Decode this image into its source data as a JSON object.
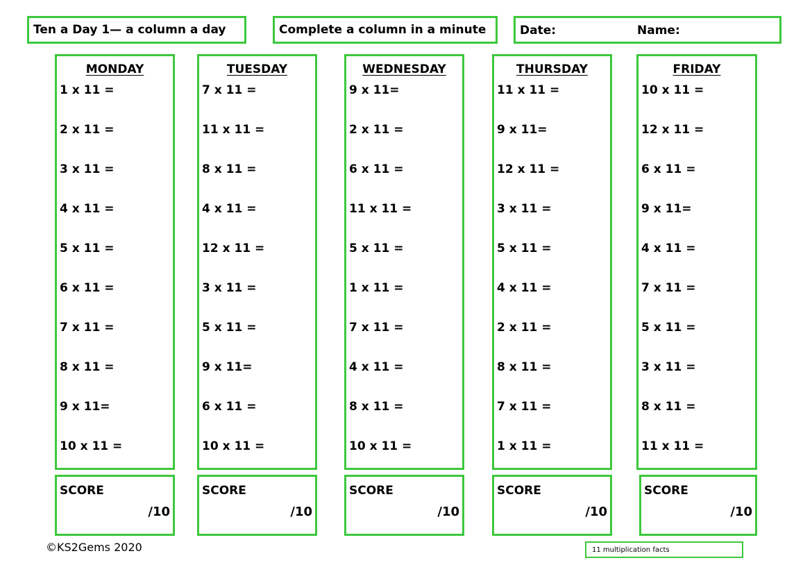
{
  "header": {
    "title": "Ten a Day 1— a column a day",
    "instruction": "Complete a column in a minute",
    "date_label": "Date:",
    "name_label": "Name:"
  },
  "columns": [
    {
      "day": "MONDAY",
      "questions": [
        "1 x 11 =",
        "2 x 11 =",
        "3 x 11 =",
        "4 x 11 =",
        "5 x 11 =",
        "6 x 11 =",
        "7 x 11 =",
        "8 x 11 =",
        "9 x 11=",
        "10 x 11 ="
      ]
    },
    {
      "day": "TUESDAY",
      "questions": [
        "7 x 11 =",
        "11 x 11 =",
        "8 x 11 =",
        "4 x 11 =",
        "12 x 11 =",
        "3 x 11 =",
        "5 x 11 =",
        "9 x 11=",
        "6 x 11 =",
        "10 x 11 ="
      ]
    },
    {
      "day": "WEDNESDAY",
      "questions": [
        "9 x 11=",
        "2 x 11 =",
        "6 x 11 =",
        "11 x 11 =",
        "5 x 11 =",
        "1 x 11 =",
        "7 x 11 =",
        "4 x 11 =",
        "8 x 11 =",
        "10 x 11 ="
      ]
    },
    {
      "day": "THURSDAY",
      "questions": [
        "11 x 11 =",
        "9 x 11=",
        "12 x 11 =",
        "3 x 11 =",
        "5 x 11 =",
        "4 x 11 =",
        "2 x 11 =",
        "8 x 11 =",
        "7 x 11 =",
        "1 x 11 ="
      ]
    },
    {
      "day": "FRIDAY",
      "questions": [
        "10 x 11 =",
        "12 x 11 =",
        "6 x 11 =",
        "9 x 11=",
        "4 x 11 =",
        "7 x 11 =",
        "5 x 11 =",
        "3 x 11 =",
        "8 x 11 =",
        "11 x 11 ="
      ]
    }
  ],
  "score": {
    "label": "SCORE",
    "out_of": "/10"
  },
  "footer": {
    "copyright": "©KS2Gems 2020",
    "topic": "11 multiplication facts"
  },
  "colors": {
    "border_green": "#3cc83c"
  }
}
